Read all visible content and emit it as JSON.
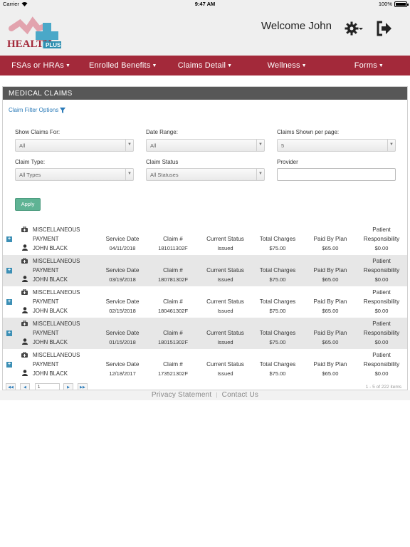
{
  "status_bar": {
    "carrier": "Carrier",
    "time": "9:47 AM",
    "battery": "100%",
    "battery_level": 1.0
  },
  "header": {
    "logo_alt": "HealthPlus",
    "welcome": "Welcome John",
    "icons": [
      "settings-gear-icon",
      "logout-icon"
    ]
  },
  "nav": {
    "items": [
      {
        "label": "FSAs or HRAs"
      },
      {
        "label": "Enrolled Benefits"
      },
      {
        "label": "Claims Detail"
      },
      {
        "label": "Wellness"
      },
      {
        "label": "Forms"
      }
    ]
  },
  "panel": {
    "title": "MEDICAL CLAIMS",
    "filter_link": "Claim Filter Options",
    "filters": {
      "show_claims_for": {
        "label": "Show Claims For:",
        "value": "All"
      },
      "date_range": {
        "label": "Date Range:",
        "value": "All"
      },
      "per_page": {
        "label": "Claims Shown per page:",
        "value": "5"
      },
      "claim_type": {
        "label": "Claim Type:",
        "value": "All Types"
      },
      "claim_status": {
        "label": "Claim Status",
        "value": "All Statuses"
      },
      "provider": {
        "label": "Provider",
        "value": ""
      }
    },
    "apply_label": "Apply"
  },
  "table": {
    "headers": {
      "service_date": "Service Date",
      "claim_no": "Claim #",
      "status": "Current Status",
      "total": "Total Charges",
      "paid": "Paid By Plan",
      "patient_resp_1": "Patient",
      "patient_resp_2": "Responsibility"
    },
    "rows": [
      {
        "provider_1": "MISCELLANEOUS",
        "provider_2": "PAYMENT",
        "patient": "JOHN BLACK",
        "service_date": "04/11/2018",
        "claim_no": "181011302F",
        "status": "Issued",
        "total": "$75.00",
        "paid": "$65.00",
        "resp": "$0.00"
      },
      {
        "provider_1": "MISCELLANEOUS",
        "provider_2": "PAYMENT",
        "patient": "JOHN BLACK",
        "service_date": "03/19/2018",
        "claim_no": "180781302F",
        "status": "Issued",
        "total": "$75.00",
        "paid": "$65.00",
        "resp": "$0.00"
      },
      {
        "provider_1": "MISCELLANEOUS",
        "provider_2": "PAYMENT",
        "patient": "JOHN BLACK",
        "service_date": "02/15/2018",
        "claim_no": "180461302F",
        "status": "Issued",
        "total": "$75.00",
        "paid": "$65.00",
        "resp": "$0.00"
      },
      {
        "provider_1": "MISCELLANEOUS",
        "provider_2": "PAYMENT",
        "patient": "JOHN BLACK",
        "service_date": "01/15/2018",
        "claim_no": "180151302F",
        "status": "Issued",
        "total": "$75.00",
        "paid": "$65.00",
        "resp": "$0.00"
      },
      {
        "provider_1": "MISCELLANEOUS",
        "provider_2": "PAYMENT",
        "patient": "JOHN BLACK",
        "service_date": "12/18/2017",
        "claim_no": "173521302F",
        "status": "Issued",
        "total": "$75.00",
        "paid": "$65.00",
        "resp": "$0.00"
      }
    ]
  },
  "pager": {
    "page": "1",
    "count_text": "1 - 5 of 222 items"
  },
  "footer": {
    "privacy": "Privacy Statement",
    "separator": "|",
    "contact": "Contact Us"
  },
  "colors": {
    "nav_bg": "#a3293a",
    "panel_head": "#575757",
    "apply": "#5fb394",
    "link": "#2a7ab8"
  }
}
